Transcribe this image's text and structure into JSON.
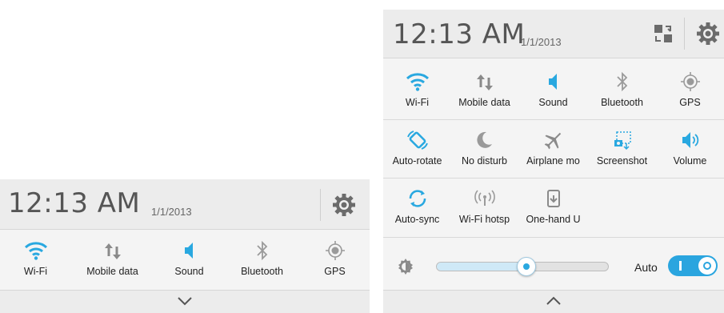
{
  "left_panel": {
    "time": "12:13 AM",
    "date": "1/1/2013",
    "tiles": [
      {
        "label": "Wi-Fi",
        "icon": "wifi-icon",
        "active": true
      },
      {
        "label": "Mobile data",
        "icon": "mobile-data-icon",
        "active": false
      },
      {
        "label": "Sound",
        "icon": "sound-icon",
        "active": true
      },
      {
        "label": "Bluetooth",
        "icon": "bluetooth-icon",
        "active": false
      },
      {
        "label": "GPS",
        "icon": "gps-icon",
        "active": false
      }
    ],
    "expand_icon": "chevron-down-icon"
  },
  "right_panel": {
    "time": "12:13 AM",
    "date": "1/1/2013",
    "tiles_row1": [
      {
        "label": "Wi-Fi",
        "icon": "wifi-icon",
        "active": true
      },
      {
        "label": "Mobile data",
        "icon": "mobile-data-icon",
        "active": false
      },
      {
        "label": "Sound",
        "icon": "sound-icon",
        "active": true
      },
      {
        "label": "Bluetooth",
        "icon": "bluetooth-icon",
        "active": false
      },
      {
        "label": "GPS",
        "icon": "gps-icon",
        "active": false
      }
    ],
    "tiles_row2": [
      {
        "label": "Auto-rotate",
        "icon": "auto-rotate-icon",
        "active": true
      },
      {
        "label": "No disturb",
        "icon": "moon-icon",
        "active": false
      },
      {
        "label": "Airplane mo",
        "icon": "airplane-icon",
        "active": false
      },
      {
        "label": "Screenshot",
        "icon": "screenshot-icon",
        "active": true
      },
      {
        "label": "Volume",
        "icon": "volume-icon",
        "active": true
      }
    ],
    "tiles_row3": [
      {
        "label": "Auto-sync",
        "icon": "sync-icon",
        "active": true
      },
      {
        "label": "Wi-Fi hotsp",
        "icon": "hotspot-icon",
        "active": false
      },
      {
        "label": "One-hand U",
        "icon": "one-hand-icon",
        "active": false
      }
    ],
    "brightness": {
      "level_fraction": 0.52,
      "auto_label": "Auto",
      "auto_on": true
    },
    "collapse_icon": "chevron-up-icon"
  },
  "colors": {
    "active": "#29a8e0",
    "inactive": "#8a8a8a",
    "panel": "#f4f4f4"
  }
}
